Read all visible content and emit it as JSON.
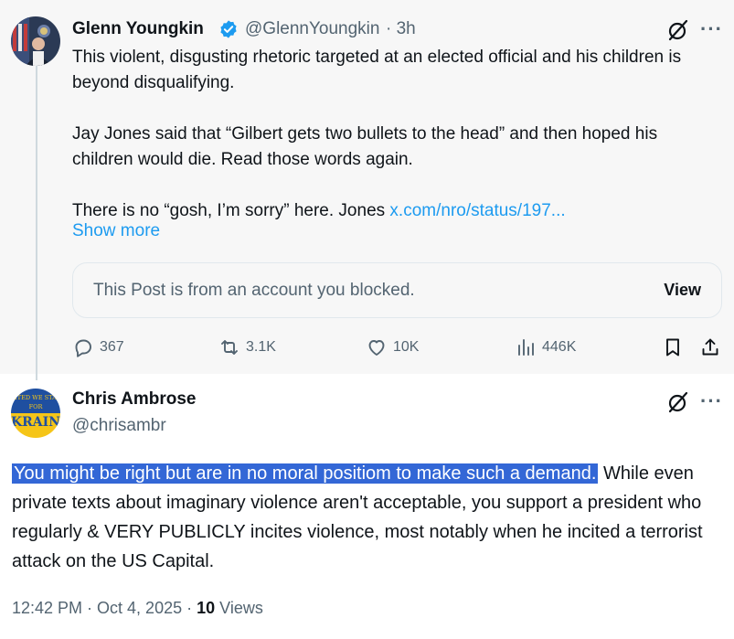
{
  "tweet1": {
    "author_name": "Glenn Youngkin",
    "handle": "@GlennYoungkin",
    "time": "· 3h",
    "paragraphs": [
      "This violent, disgusting rhetoric targeted at an elected official and his children is beyond disqualifying.",
      "Jay Jones said that “Gilbert gets two bullets to the head” and then hoped his children would die. Read those words again."
    ],
    "para3_text": "There is no “gosh, I’m sorry” here. Jones ",
    "para3_link": "x.com/nro/status/197...",
    "show_more": "Show more",
    "blocked_notice": "This Post is from an account you blocked.",
    "blocked_action": "View",
    "stats": {
      "replies": "367",
      "reposts": "3.1K",
      "likes": "10K",
      "views": "446K"
    }
  },
  "tweet2": {
    "author_name": "Chris Ambrose",
    "handle": "@chrisambr",
    "highlighted_text": "You might be right but are in no moral positiom to make such a demand.",
    "body_text": "While even private texts about imaginary violence aren't acceptable, you support a president who regularly & VERY PUBLICLY incites violence, most notably when he incited a terrorist attack on the US Capital.",
    "timestamp": "12:42 PM · Oct 4, 2025 · ",
    "views_count": "10",
    "views_label": " Views",
    "avatar_text_line1": "NITED WE STAN",
    "avatar_text_line2": "FOR",
    "avatar_text_line3": "KRAIN"
  },
  "colors": {
    "accent": "#1d9bf0",
    "highlight": "#3367d6",
    "muted": "#536471",
    "ukraine_blue": "#1f4fa0",
    "ukraine_yellow": "#f5c518"
  },
  "icons": [
    "verified-badge-icon",
    "grok-icon",
    "more-icon",
    "reply-icon",
    "repost-icon",
    "like-icon",
    "views-icon",
    "bookmark-icon",
    "share-icon"
  ]
}
